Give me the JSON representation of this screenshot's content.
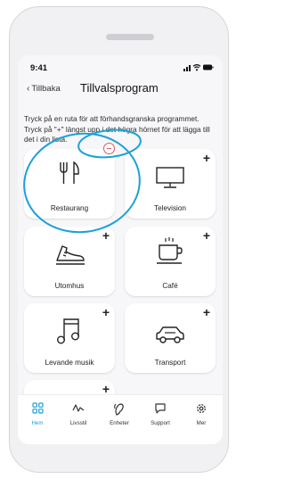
{
  "status": {
    "time": "9:41"
  },
  "nav": {
    "back_label": "Tillbaka",
    "title": "Tillvalsprogram"
  },
  "instructions": "Tryck på en ruta för att förhandsgranska programmet. Tryck på \"+\" längst upp i det högra hörnet för att lägga till det i din lista.",
  "cards": [
    {
      "label": "Restaurang",
      "icon": "cutlery-icon",
      "added": true
    },
    {
      "label": "Television",
      "icon": "tv-icon",
      "added": false
    },
    {
      "label": "Utomhus",
      "icon": "shoe-icon",
      "added": false
    },
    {
      "label": "Café",
      "icon": "coffee-cup-icon",
      "added": false
    },
    {
      "label": "Levande musik",
      "icon": "music-note-icon",
      "added": false
    },
    {
      "label": "Transport",
      "icon": "car-icon",
      "added": false
    }
  ],
  "plus_symbol": "+",
  "tabs": [
    {
      "label": "Hem",
      "icon": "home-grid-icon",
      "active": true
    },
    {
      "label": "Livsstil",
      "icon": "activity-icon",
      "active": false
    },
    {
      "label": "Enheter",
      "icon": "hearing-aid-icon",
      "active": false
    },
    {
      "label": "Support",
      "icon": "chat-bubble-icon",
      "active": false
    },
    {
      "label": "Mer",
      "icon": "gear-icon",
      "active": false
    }
  ],
  "colors": {
    "accent": "#1aa0d8",
    "remove": "#e2555f",
    "annotation": "#1aa0d8"
  }
}
